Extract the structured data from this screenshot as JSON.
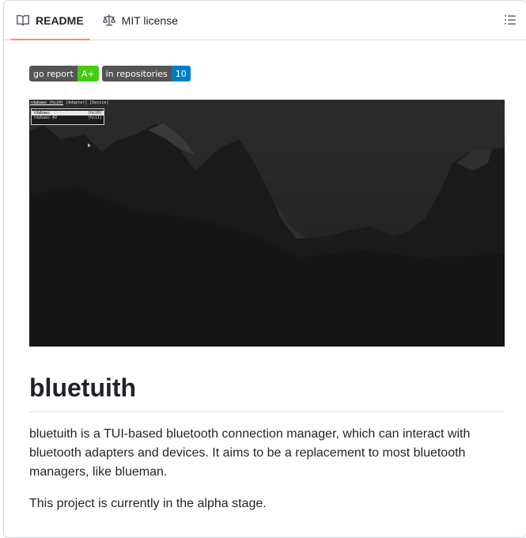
{
  "tabs": [
    {
      "label": "README",
      "icon": "book-icon",
      "active": true
    },
    {
      "label": "MIT license",
      "icon": "law-scale-icon",
      "active": false
    }
  ],
  "outline_button": {
    "icon": "list-unordered-icon"
  },
  "badges": [
    {
      "left": "go report",
      "right": "A+",
      "right_color": "#44cc11"
    },
    {
      "left": "in repositories",
      "right": "10",
      "right_color": "#007ec6"
    }
  ],
  "screenshot": {
    "menu_bar": [
      "rdabaws (hci0)",
      "[Adapter]",
      "[Device]"
    ],
    "adapter_list": [
      {
        "name": "rdabaws",
        "id": "(hci0)",
        "selected": true
      },
      {
        "name": "rdabaws #2",
        "id": "(hci1)",
        "selected": false
      }
    ]
  },
  "readme": {
    "title": "bluetuith",
    "paragraph1": "bluetuith is a TUI-based bluetooth connection manager, which can interact with bluetooth adapters and devices. It aims to be a replacement to most bluetooth managers, like blueman.",
    "paragraph2": "This project is currently in the alpha stage."
  },
  "colors": {
    "tab_underline": "#fd8c73",
    "border": "#d0d7de",
    "text": "#1f2328"
  }
}
